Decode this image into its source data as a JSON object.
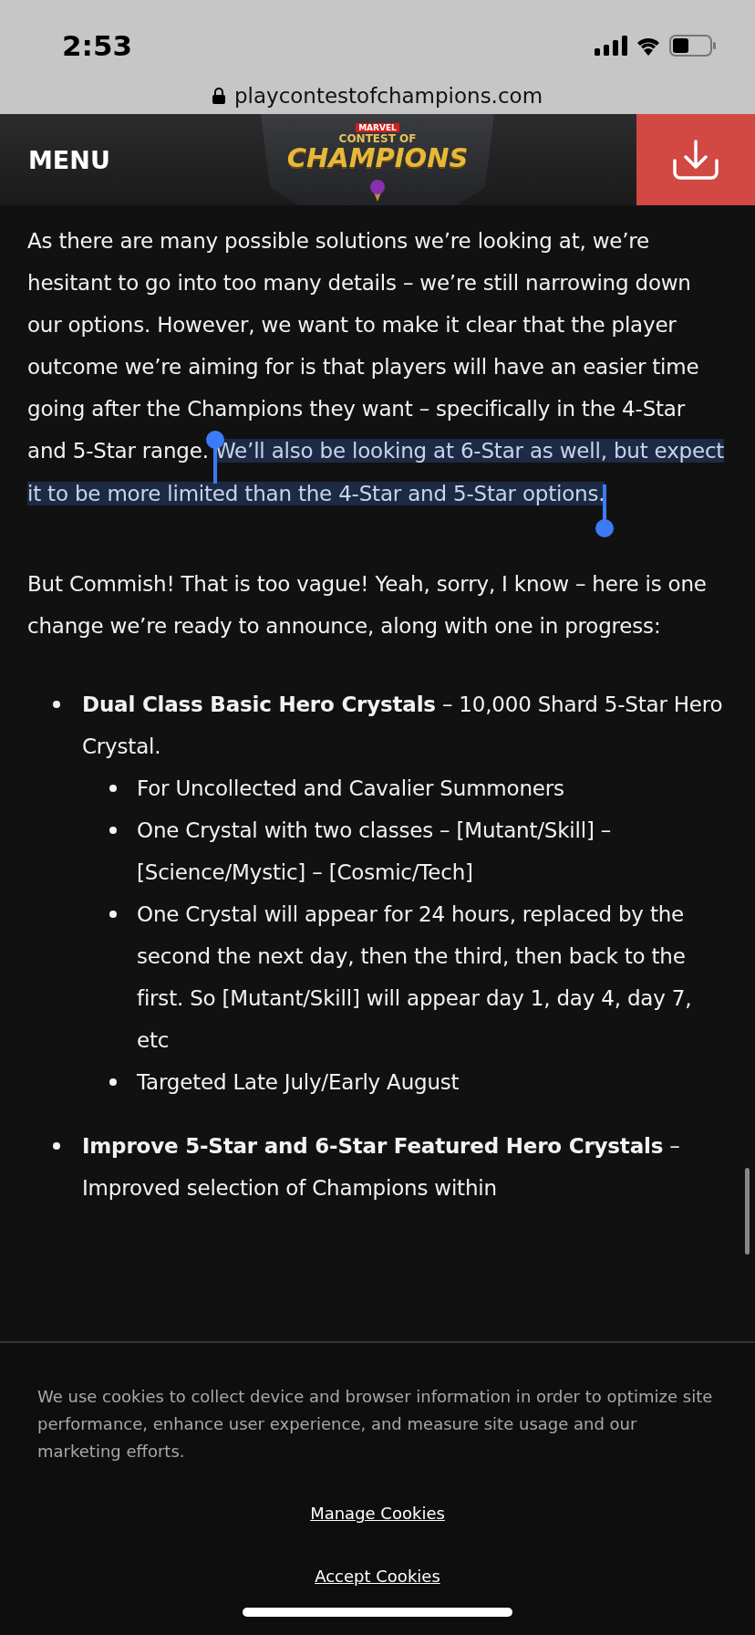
{
  "status_bar": {
    "time": "2:53",
    "url": "playcontestofchampions.com"
  },
  "header": {
    "menu": "MENU",
    "logo": {
      "brand": "MARVEL",
      "line1": "CONTEST OF",
      "line2": "CHAMPIONS"
    }
  },
  "article": {
    "paragraphs": [
      {
        "text": "As there are many possible solutions we’re looking at, we’re hesitant to go into too many details – we’re still narrowing down our options.  However, we want to make it clear that the player outcome we’re aiming for is that players will have an easier time going after the Champions they want – specifically in the 4-Star and 5-Star range. ",
        "selected_text": "We’ll also be looking at 6-Star as well, but expect it to be more limited than the 4-Star and 5-Star options."
      },
      {
        "text": "But Commish! That is too vague! Yeah, sorry, I know – here is one change we’re ready to announce, along with one in progress:"
      }
    ],
    "bullets": [
      {
        "text": "**Dual Class Basic Hero Crystals** – 10,000 Shard 5-Star Hero Crystal.",
        "children": [
          {
            "text": "For Uncollected and Cavalier Summoners"
          },
          {
            "text": "One Crystal with two classes – [Mutant/Skill] – [Science/Mystic] – [Cosmic/Tech]"
          },
          {
            "text": "One Crystal will appear for 24 hours, replaced by the second the next day, then the third, then back to the first. So [Mutant/Skill] will appear day 1, day 4, day 7, etc"
          },
          {
            "text": "Targeted Late July/Early August"
          }
        ]
      },
      {
        "text": "**Improve 5-Star and 6-Star Featured Hero Crystals** – Improved selection of Champions within"
      }
    ]
  },
  "cookie_banner": {
    "message": "We use cookies to collect device and browser information in order to optimize site performance, enhance user experience, and measure site usage and our marketing efforts.",
    "links": [
      "Manage Cookies",
      "Accept Cookies"
    ]
  }
}
